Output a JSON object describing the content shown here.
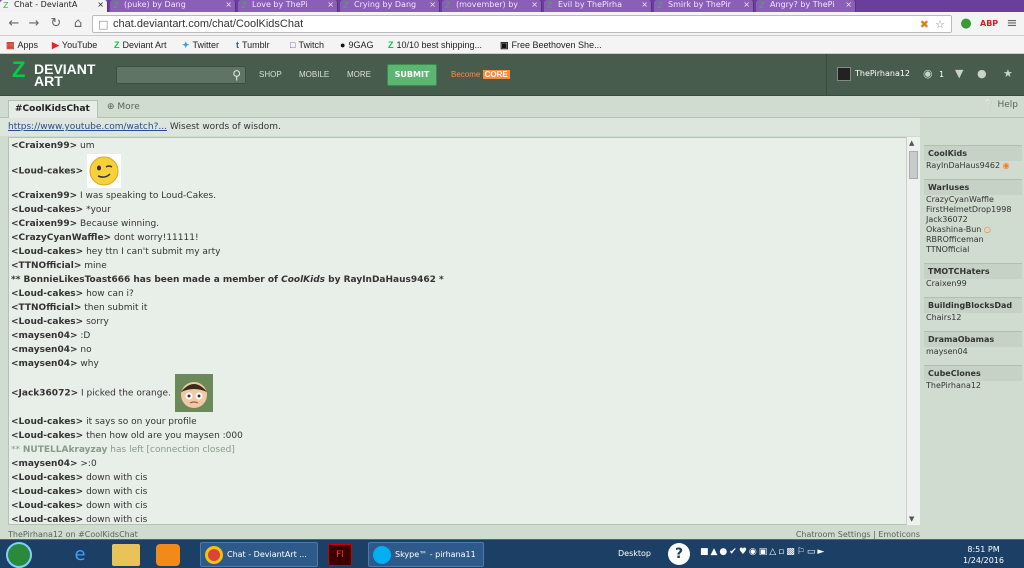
{
  "browser": {
    "tabs": [
      {
        "label": "Chat - DeviantA",
        "active": true
      },
      {
        "label": "(puke) by Dang",
        "active": false
      },
      {
        "label": "Love by ThePi",
        "active": false
      },
      {
        "label": "Crying by Dang",
        "active": false
      },
      {
        "label": "(movember) by",
        "active": false
      },
      {
        "label": "Evil by ThePirha",
        "active": false
      },
      {
        "label": "Smirk by ThePir",
        "active": false
      },
      {
        "label": "Angry? by ThePi",
        "active": false
      }
    ],
    "url": "chat.deviantart.com/chat/CoolKidsChat",
    "bookmarks": [
      "Apps",
      "YouTube",
      "Deviant Art",
      "Twitter",
      "Tumblr",
      "Twitch",
      "9GAG",
      "10/10 best shipping...",
      "Free Beethoven She..."
    ]
  },
  "deviantart": {
    "logo_line1": "DEVIANT",
    "logo_line2": "ART",
    "nav": [
      "SHOP",
      "MOBILE",
      "MORE"
    ],
    "submit": "SUBMIT",
    "become": "Become",
    "core": "CORE",
    "username": "ThePirhana12",
    "watch_count": "1"
  },
  "chat": {
    "room_tab": "#CoolKidsChat",
    "more_tab": "More",
    "help": "Help",
    "topic_link": "https://www.youtube.com/watch?...",
    "topic_text": "Wisest words of wisdom.",
    "messages": [
      {
        "nick": "<Craixen99>",
        "text": "um"
      },
      {
        "nick": "<Loud-cakes>",
        "text": "",
        "emote": "smirk"
      },
      {
        "nick": "<Craixen99>",
        "text": "I was speaking to Loud-Cakes."
      },
      {
        "nick": "<Loud-cakes>",
        "text": "*your"
      },
      {
        "nick": "<Craixen99>",
        "text": "Because winning."
      },
      {
        "nick": "<CrazyCyanWaffle>",
        "text": "dont worry!11111!"
      },
      {
        "nick": "<Loud-cakes>",
        "text": "hey ttn I can't submit my arty"
      },
      {
        "nick": "<TTNOfficial>",
        "text": "mine"
      },
      {
        "sys_pre": "** BonnieLikesToast666 has been made a member of ",
        "sys_group": "CoolKids",
        "sys_post": " by RayInDaHaus9462 *"
      },
      {
        "nick": "<Loud-cakes>",
        "text": "how can i?"
      },
      {
        "nick": "<TTNOfficial>",
        "text": "then submit it"
      },
      {
        "nick": "<Loud-cakes>",
        "text": "sorry"
      },
      {
        "nick": "<maysen04>",
        "text": ":D"
      },
      {
        "nick": "<maysen04>",
        "text": "no"
      },
      {
        "nick": "<maysen04>",
        "text": "why"
      },
      {
        "nick": "<Jack36072>",
        "text": "I picked the orange.",
        "emote": "face"
      },
      {
        "nick": "<Loud-cakes>",
        "text": "it says so on your profile"
      },
      {
        "nick": "<Loud-cakes>",
        "text": "then how old are you maysen :000"
      },
      {
        "leave_pre": "** ",
        "leave_nick": "NUTELLAkrayzay",
        "leave_post": " has left [connection closed]"
      },
      {
        "nick": "<maysen04>",
        "text": ">:0"
      },
      {
        "nick": "<Loud-cakes>",
        "text": "down with cis"
      },
      {
        "nick": "<Loud-cakes>",
        "text": "down with cis"
      },
      {
        "nick": "<Loud-cakes>",
        "text": "down with cis"
      },
      {
        "nick": "<Loud-cakes>",
        "text": "down with cis"
      }
    ],
    "groups": [
      {
        "name": "CoolKids",
        "members": [
          "RayInDaHaus9462"
        ]
      },
      {
        "name": "Warluses",
        "members": [
          "CrazyCyanWaffle",
          "FirstHelmetDrop1998",
          "Jack36072",
          "Okashina-Bun",
          "RBROfficeman",
          "TTNOfficial"
        ]
      },
      {
        "name": "TMOTCHaters",
        "members": [
          "Craixen99"
        ]
      },
      {
        "name": "BuildingBlocksDad",
        "members": [
          "Chairs12"
        ]
      },
      {
        "name": "DramaObamas",
        "members": [
          "maysen04"
        ]
      },
      {
        "name": "CubeClones",
        "members": [
          "ThePirhana12"
        ]
      }
    ],
    "status_left": "ThePirhana12 on #CoolKidsChat",
    "status_right": "Chatroom Settings | Emoticons"
  },
  "taskbar": {
    "buttons": [
      "Chat - DeviantArt ...",
      "Skype™ - pirhana11"
    ],
    "desktop": "Desktop",
    "time": "8:51 PM",
    "date": "1/24/2016"
  }
}
